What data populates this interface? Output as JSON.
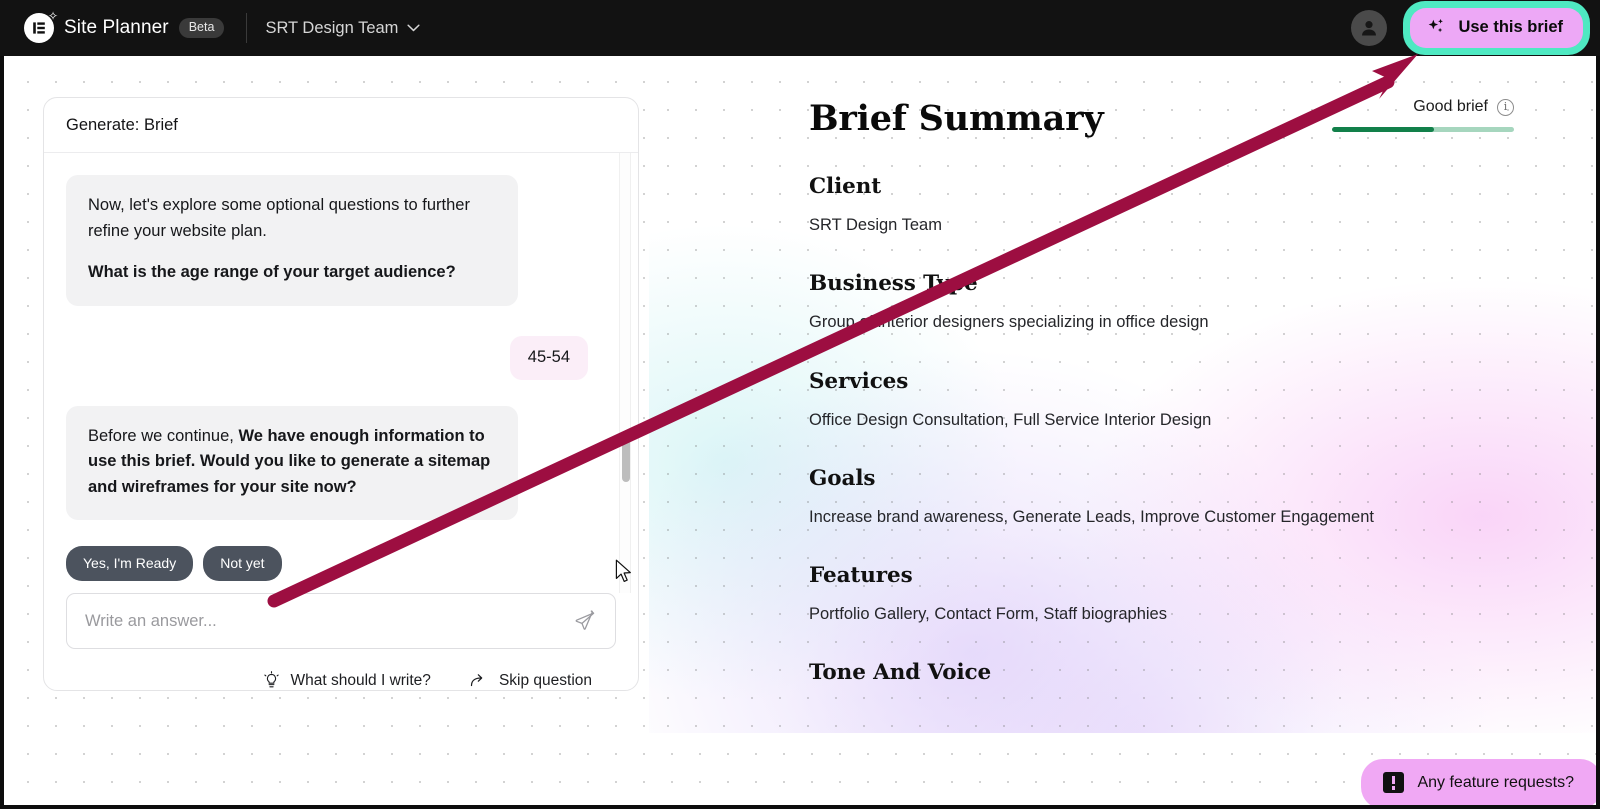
{
  "topbar": {
    "logo_icon": "elementor-logo-icon",
    "sparkle_icon": "sparkle-icon",
    "brand_name": "Site Planner",
    "beta_label": "Beta",
    "team_name": "SRT Design Team",
    "team_chevron_icon": "chevron-down-icon",
    "avatar_icon": "user-avatar-icon",
    "cta_label": "Use this brief",
    "cta_icon": "sparkles-icon",
    "cta_bg": "#eda8f6",
    "cta_ring": "#4fe9c2"
  },
  "chat": {
    "header_title": "Generate: Brief",
    "messages": [
      {
        "role": "assistant",
        "paragraph_1": "Now, let's explore some optional questions to further refine your website plan.",
        "paragraph_2": "What is the age range of your target audience?"
      },
      {
        "role": "user",
        "text": "45-54"
      },
      {
        "role": "assistant",
        "lead": "Before we continue, ",
        "bold": "We have enough information to use this brief. Would you like to generate a sitemap and wireframes for your site now?"
      }
    ],
    "quick_replies": [
      {
        "label": "Yes, I'm Ready"
      },
      {
        "label": "Not yet"
      }
    ],
    "composer": {
      "placeholder": "Write an answer...",
      "value": "",
      "send_icon": "send-paper-plane-icon"
    },
    "actions": [
      {
        "label": "What should I write?",
        "icon": "lightbulb-icon"
      },
      {
        "label": "Skip question",
        "icon": "skip-arrow-icon"
      }
    ],
    "scrollbar": {
      "visible": true
    }
  },
  "brief": {
    "title": "Brief Summary",
    "quality": {
      "label": "Good brief",
      "info_icon": "info-icon",
      "info_glyph": "i",
      "fill_percent": 56,
      "fill_color": "#12804a",
      "track_color": "#a6d6be"
    },
    "sections": [
      {
        "heading": "Client",
        "value": "SRT Design Team"
      },
      {
        "heading": "Business Type",
        "value": "Group of interior designers specializing in office design"
      },
      {
        "heading": "Services",
        "value": "Office Design Consultation, Full Service Interior Design"
      },
      {
        "heading": "Goals",
        "value": "Increase brand awareness, Generate Leads, Improve Customer Engagement"
      },
      {
        "heading": "Features",
        "value": "Portfolio Gallery, Contact Form, Staff biographies"
      },
      {
        "heading": "Tone And Voice",
        "value": ""
      }
    ]
  },
  "feature_widget": {
    "label": "Any feature requests?",
    "icon": "feedback-bubble-icon",
    "bg": "#f0a8f4"
  },
  "annotation": {
    "arrow_color": "#9d0e41",
    "from": "chat composer area",
    "to": "Use this brief button"
  }
}
